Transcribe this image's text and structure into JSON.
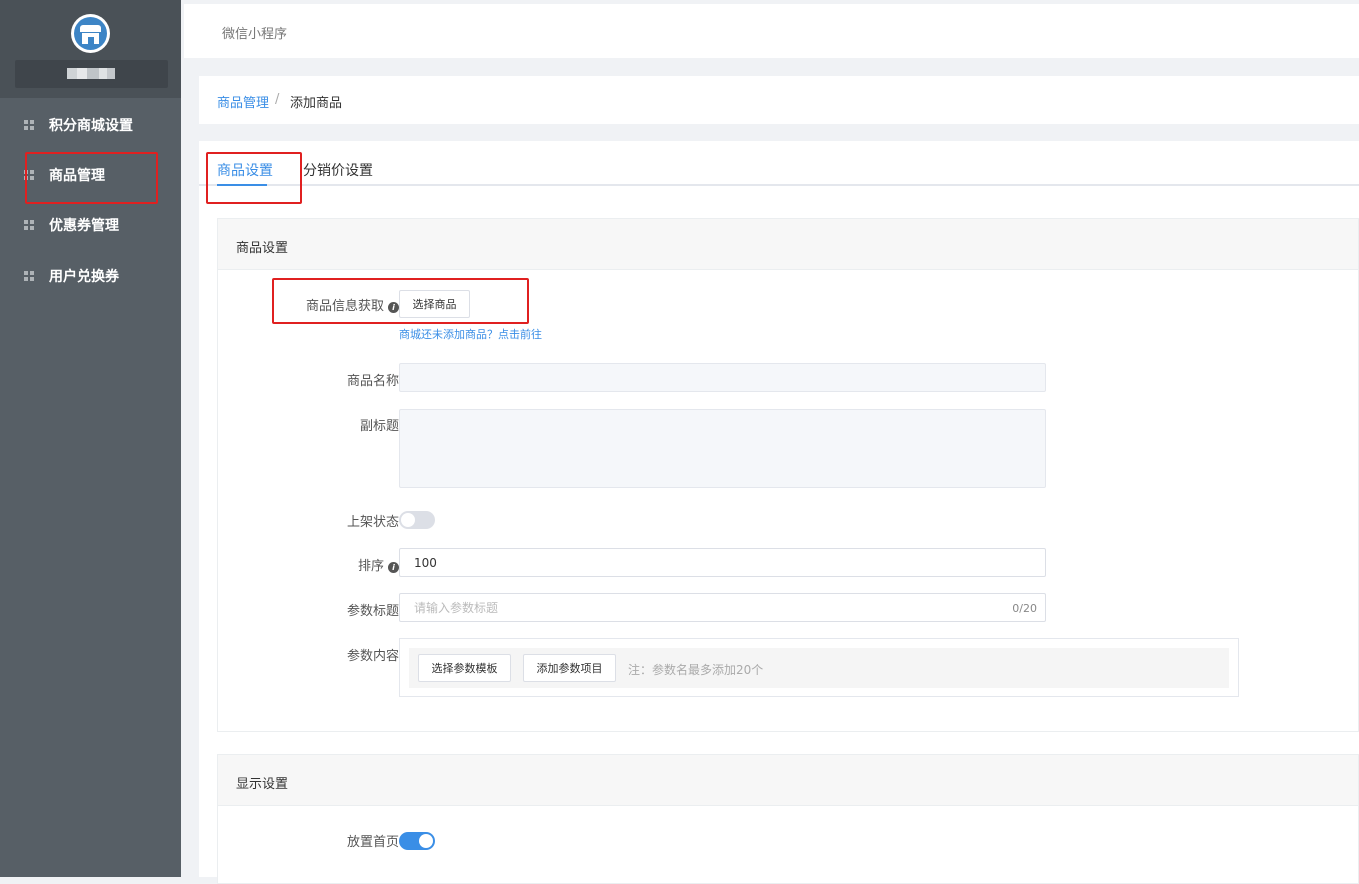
{
  "sidebar": {
    "items": [
      {
        "label": "积分商城设置"
      },
      {
        "label": "商品管理"
      },
      {
        "label": "优惠券管理"
      },
      {
        "label": "用户兑换券"
      }
    ]
  },
  "topbar": {
    "title": "微信小程序"
  },
  "breadcrumb": {
    "parent": "商品管理",
    "separator": "/",
    "current": "添加商品"
  },
  "tabs": [
    {
      "label": "商品设置",
      "active": true
    },
    {
      "label": "分销价设置",
      "active": false
    }
  ],
  "product_settings": {
    "heading": "商品设置",
    "fetch_label": "商品信息获取",
    "select_button": "选择商品",
    "hint_link": "商城还未添加商品？点击前往",
    "name_label": "商品名称",
    "name_value": "",
    "subtitle_label": "副标题",
    "subtitle_value": "",
    "status_label": "上架状态",
    "status_on": false,
    "sort_label": "排序",
    "sort_value": "100",
    "param_title_label": "参数标题",
    "param_title_placeholder": "请输入参数标题",
    "param_title_counter": "0/20",
    "param_content_label": "参数内容",
    "select_template_button": "选择参数模板",
    "add_param_button": "添加参数项目",
    "param_note": "注：参数名最多添加20个"
  },
  "display_settings": {
    "heading": "显示设置",
    "homepage_label": "放置首页",
    "homepage_on": true
  },
  "colors": {
    "accent": "#3a8ee6",
    "highlight": "#e02020",
    "sidebar": "#575f66"
  }
}
